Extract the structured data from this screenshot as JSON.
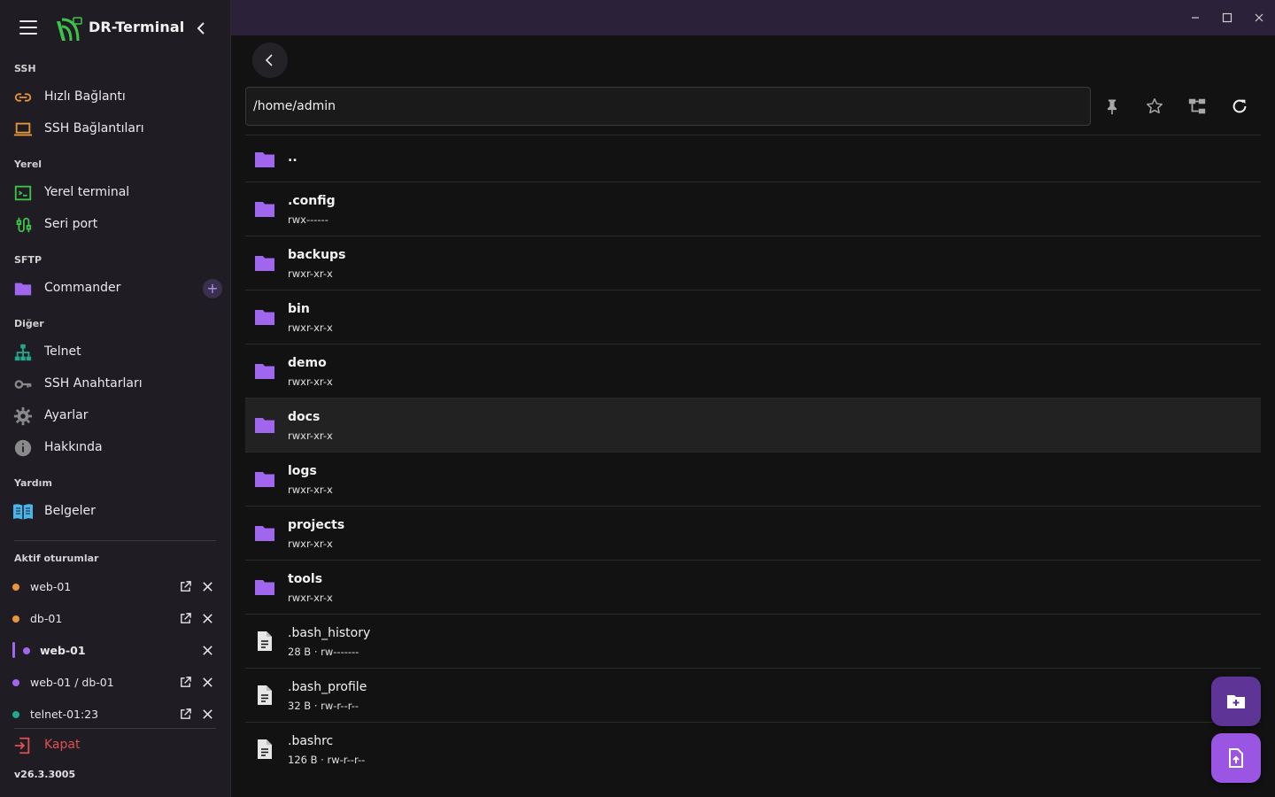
{
  "app": {
    "title": "DR-Terminal",
    "version": "v26.3.3005"
  },
  "colors": {
    "accent": "#9a55e2",
    "sidebar": "#1f1c24",
    "titlebar": "#2b2139",
    "danger": "#e0504f",
    "orange": "#e8963a",
    "purple": "#a066ee",
    "teal": "#20a98b",
    "green": "#3fc24a",
    "blue": "#4ab5e8"
  },
  "sidebar": {
    "sections": {
      "ssh": "SSH",
      "local": "Yerel",
      "sftp": "SFTP",
      "other": "Diğer",
      "help": "Yardım",
      "sessions": "Aktif oturumlar"
    },
    "items": {
      "quick_connect": {
        "label": "Hızlı Bağlantı",
        "icon": "link-icon"
      },
      "ssh_connections": {
        "label": "SSH Bağlantıları",
        "icon": "laptop-icon"
      },
      "local_terminal": {
        "label": "Yerel terminal",
        "icon": "terminal-icon"
      },
      "serial_port": {
        "label": "Seri port",
        "icon": "cable-icon"
      },
      "commander": {
        "label": "Commander",
        "icon": "folder-icon"
      },
      "telnet": {
        "label": "Telnet",
        "icon": "network-icon"
      },
      "ssh_keys": {
        "label": "SSH Anahtarları",
        "icon": "key-icon"
      },
      "settings": {
        "label": "Ayarlar",
        "icon": "gear-icon"
      },
      "about": {
        "label": "Hakkında",
        "icon": "info-icon"
      },
      "docs": {
        "label": "Belgeler",
        "icon": "book-icon"
      }
    },
    "add_label": "+",
    "sessions": [
      {
        "label": "web-01",
        "color": "#e8963a",
        "openable": true,
        "active": false
      },
      {
        "label": "db-01",
        "color": "#e8963a",
        "openable": true,
        "active": false
      },
      {
        "label": "web-01",
        "color": "#a066ee",
        "openable": false,
        "active": true
      },
      {
        "label": "web-01 / db-01",
        "color": "#a066ee",
        "openable": true,
        "active": false
      },
      {
        "label": "telnet-01:23",
        "color": "#20a98b",
        "openable": true,
        "active": false
      }
    ],
    "close_label": "Kapat"
  },
  "toolbar": {
    "path": "/home/admin",
    "tools": [
      "pin-icon",
      "star-icon",
      "tree-icon",
      "refresh-icon"
    ]
  },
  "files": [
    {
      "name": "..",
      "meta": "",
      "type": "folder"
    },
    {
      "name": ".config",
      "meta": "rwx------",
      "type": "folder"
    },
    {
      "name": "backups",
      "meta": "rwxr-xr-x",
      "type": "folder"
    },
    {
      "name": "bin",
      "meta": "rwxr-xr-x",
      "type": "folder"
    },
    {
      "name": "demo",
      "meta": "rwxr-xr-x",
      "type": "folder"
    },
    {
      "name": "docs",
      "meta": "rwxr-xr-x",
      "type": "folder",
      "selected": true
    },
    {
      "name": "logs",
      "meta": "rwxr-xr-x",
      "type": "folder"
    },
    {
      "name": "projects",
      "meta": "rwxr-xr-x",
      "type": "folder"
    },
    {
      "name": "tools",
      "meta": "rwxr-xr-x",
      "type": "folder"
    },
    {
      "name": ".bash_history",
      "meta": "28 B · rw-------",
      "type": "file"
    },
    {
      "name": ".bash_profile",
      "meta": "32 B · rw-r--r--",
      "type": "file"
    },
    {
      "name": ".bashrc",
      "meta": "126 B · rw-r--r--",
      "type": "file"
    }
  ],
  "fabs": [
    "new-folder-icon",
    "upload-file-icon"
  ]
}
